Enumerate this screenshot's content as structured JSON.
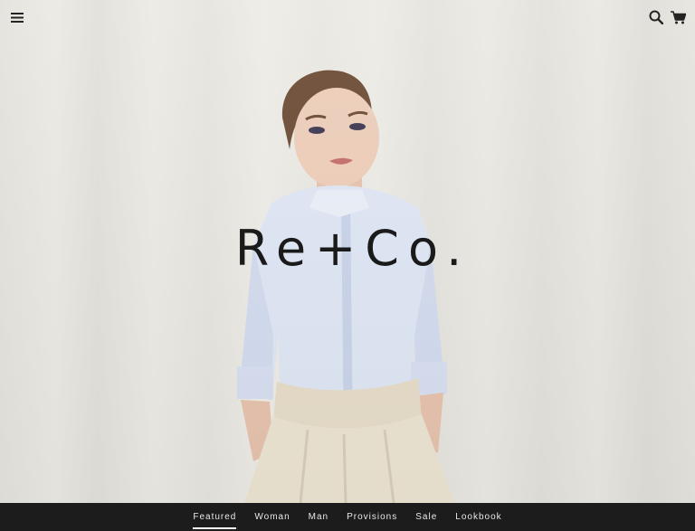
{
  "header": {
    "menu_icon": "hamburger-menu-icon",
    "search_icon": "search-icon",
    "cart_icon": "cart-icon"
  },
  "hero": {
    "logo_text": "Re+Co."
  },
  "nav": {
    "items": [
      {
        "label": "Featured",
        "active": true
      },
      {
        "label": "Woman",
        "active": false
      },
      {
        "label": "Man",
        "active": false
      },
      {
        "label": "Provisions",
        "active": false
      },
      {
        "label": "Sale",
        "active": false
      },
      {
        "label": "Lookbook",
        "active": false
      }
    ]
  },
  "colors": {
    "nav_background": "#1c1c1c",
    "nav_text": "#e8e8e8",
    "logo": "#111111",
    "wall": "#e9e7e1"
  }
}
